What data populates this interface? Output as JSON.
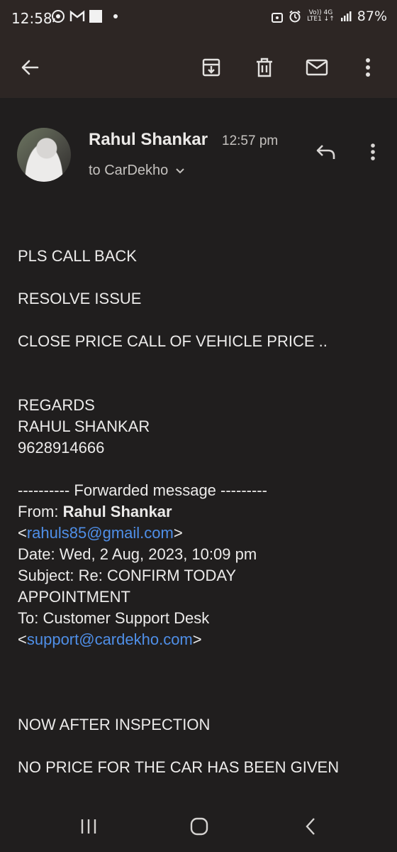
{
  "status_bar": {
    "time": "12:58",
    "network_top": "Vo)) 4G",
    "network_bottom": "LTE1 ↓↑",
    "battery": "87%"
  },
  "toolbar": {
    "back_icon": "arrow-left-icon",
    "archive_icon": "archive-icon",
    "delete_icon": "trash-icon",
    "unread_icon": "mail-icon",
    "more_icon": "more-vert-icon"
  },
  "email": {
    "sender": "Rahul Shankar",
    "time": "12:57 pm",
    "to": "to CarDekho",
    "body": {
      "line1": "PLS CALL BACK",
      "line2": "RESOLVE ISSUE",
      "line3": "CLOSE PRICE CALL OF VEHICLE PRICE ..",
      "regards": "REGARDS",
      "sig_name": "RAHUL SHANKAR",
      "sig_phone": "9628914666",
      "fwd_header": "---------- Forwarded message ---------",
      "from_label": "From: ",
      "from_name": "Rahul Shankar",
      "lt1": "<",
      "from_email": "rahuls85@gmail.com",
      "gt1": ">",
      "date": "Date: Wed, 2 Aug, 2023, 10:09 pm",
      "subject1": "Subject: Re: CONFIRM TODAY",
      "subject2": "APPOINTMENT",
      "to_line": "To: Customer Support Desk",
      "lt2": "<",
      "to_email": "support@cardekho.com",
      "gt2": ">",
      "line4": "NOW AFTER INSPECTION",
      "line5": "NO PRICE FOR THE CAR HAS BEEN GIVEN"
    }
  },
  "colors": {
    "background": "#201e1e",
    "toolbar": "#2d2624",
    "link": "#4f8fe8",
    "text": "#ecebea"
  }
}
